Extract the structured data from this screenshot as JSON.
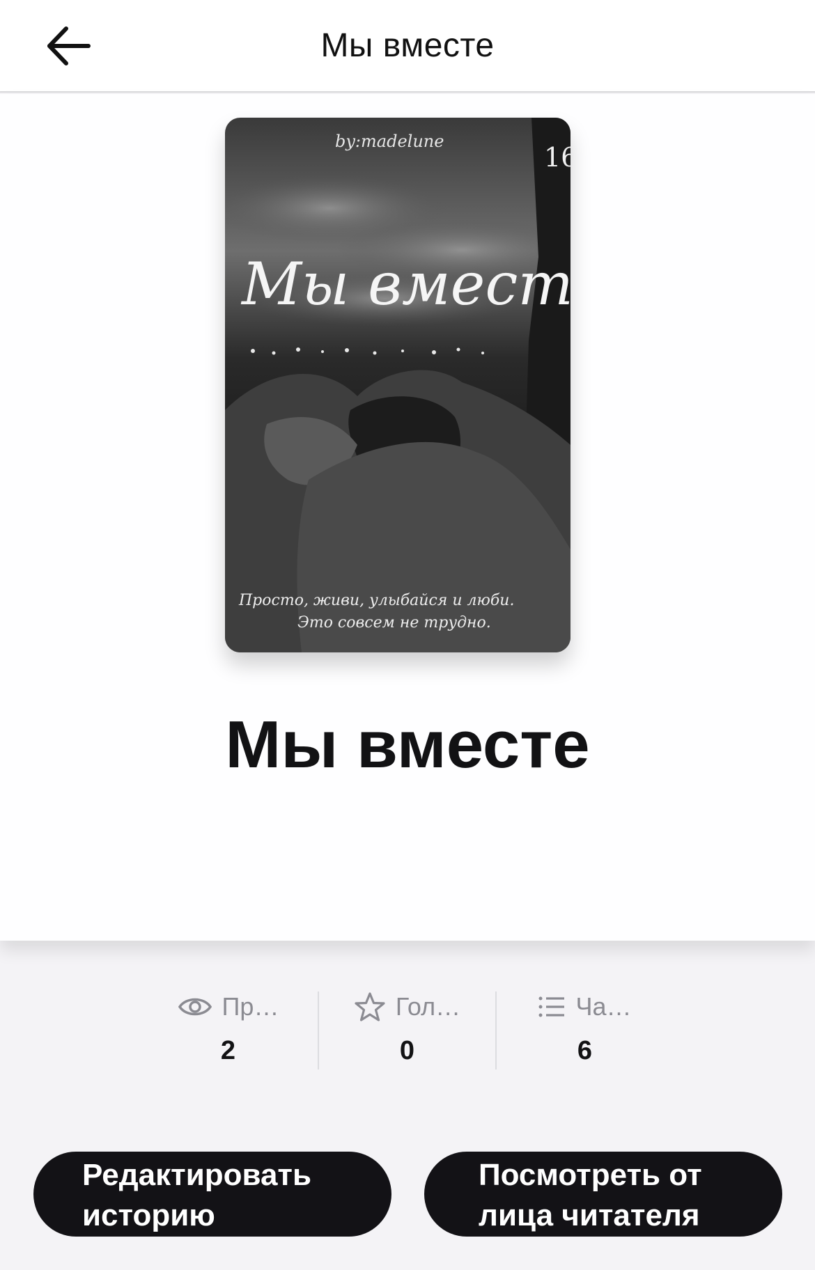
{
  "header": {
    "title": "Мы вместе",
    "back_icon": "arrow-left-icon"
  },
  "cover": {
    "author": "by:madelune",
    "corner": "16",
    "script_title": "Мы вместе",
    "tagline_line1": "Просто, живи, улыбайся и люби.",
    "tagline_line2": "Это совсем не трудно."
  },
  "story": {
    "title": "Мы вместе"
  },
  "stats": [
    {
      "icon": "eye-icon",
      "label": "Пр…",
      "value": "2"
    },
    {
      "icon": "star-icon",
      "label": "Гол…",
      "value": "0"
    },
    {
      "icon": "list-icon",
      "label": "Ча…",
      "value": "6"
    }
  ],
  "buttons": {
    "edit_line1": "Редактировать",
    "edit_line2": "историю",
    "view_line1": "Посмотреть от",
    "view_line2": "лица читателя"
  },
  "colors": {
    "button_bg": "#131216",
    "background": "#f4f3f6",
    "muted_text": "#8b8b92"
  }
}
